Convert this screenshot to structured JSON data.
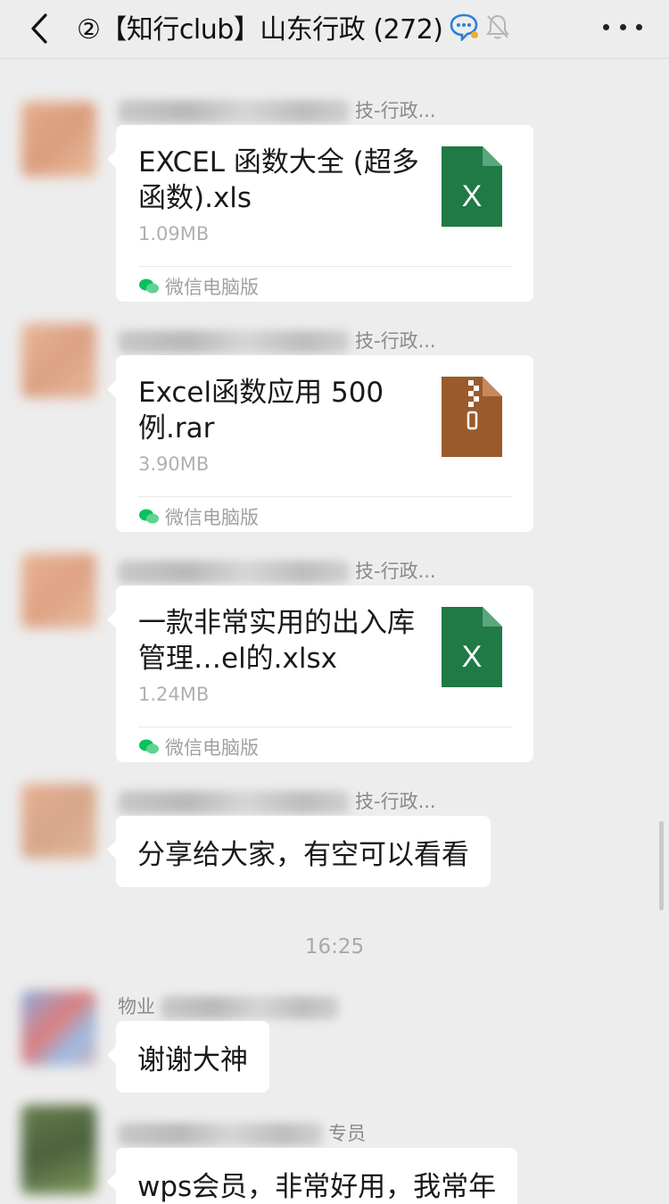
{
  "header": {
    "title": "②【知行club】山东行政 (272)"
  },
  "messages": [
    {
      "sender": "技-行政...",
      "file_name": "EXCEL 函数大全 (超多函数).xls",
      "file_size": "1.09MB",
      "source": "微信电脑版",
      "icon": "excel-file-icon",
      "icon_letter": "X"
    },
    {
      "sender": "技-行政...",
      "file_name": "Excel函数应用 500 例.rar",
      "file_size": "3.90MB",
      "source": "微信电脑版",
      "icon": "zip-file-icon"
    },
    {
      "sender": "技-行政...",
      "file_name": "一款非常实用的出入库管理…el的.xlsx",
      "file_size": "1.24MB",
      "source": "微信电脑版",
      "icon": "excel-file-icon",
      "icon_letter": "X"
    },
    {
      "sender": "技-行政...",
      "text": "分享给大家，有空可以看看"
    }
  ],
  "timestamp": "16:25",
  "later_messages": [
    {
      "sender": "物业",
      "text": "谢谢大神"
    },
    {
      "sender": "专员",
      "text": "wps会员，非常好用，我常年"
    }
  ],
  "colors": {
    "background": "#ededed",
    "bubble": "#ffffff",
    "excel_green": "#1f7a45",
    "zip_brown": "#9a5a2b",
    "wechat_green": "#07c160"
  }
}
